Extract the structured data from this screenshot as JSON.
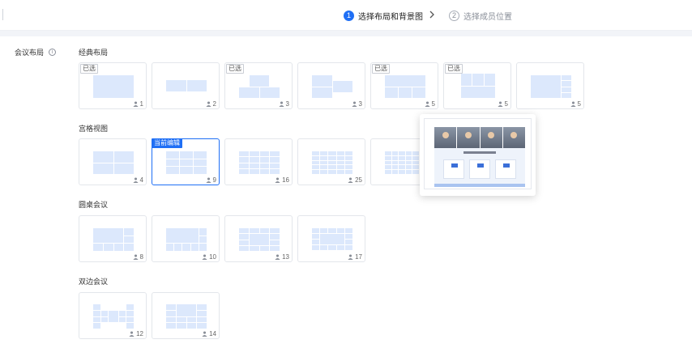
{
  "steps": [
    {
      "num": "1",
      "label": "选择布局和背景图"
    },
    {
      "num": "2",
      "label": "选择成员位置"
    }
  ],
  "sidebar": {
    "label": "会议布局",
    "info_glyph": "i"
  },
  "sections": [
    {
      "title": "经典布局",
      "cards": [
        {
          "badge": "已选",
          "count": "1"
        },
        {
          "badge": "",
          "count": "2"
        },
        {
          "badge": "已选",
          "count": "3"
        },
        {
          "badge": "",
          "count": "3"
        },
        {
          "badge": "已选",
          "count": "5"
        },
        {
          "badge": "已选",
          "count": "5"
        },
        {
          "badge": "",
          "count": "5"
        }
      ]
    },
    {
      "title": "宫格视图",
      "cards": [
        {
          "badge": "",
          "count": "4"
        },
        {
          "badge": "当前编辑",
          "count": "9"
        },
        {
          "badge": "",
          "count": "16"
        },
        {
          "badge": "",
          "count": "25"
        },
        {
          "badge": "",
          "count": ""
        }
      ]
    },
    {
      "title": "圆桌会议",
      "cards": [
        {
          "badge": "",
          "count": "8"
        },
        {
          "badge": "",
          "count": "10"
        },
        {
          "badge": "",
          "count": "13"
        },
        {
          "badge": "",
          "count": "17"
        }
      ]
    },
    {
      "title": "双边会议",
      "cards": [
        {
          "badge": "",
          "count": "12"
        },
        {
          "badge": "",
          "count": "14"
        }
      ]
    }
  ],
  "colors": {
    "accent": "#1f6ff5",
    "tile": "#dce8fc"
  }
}
